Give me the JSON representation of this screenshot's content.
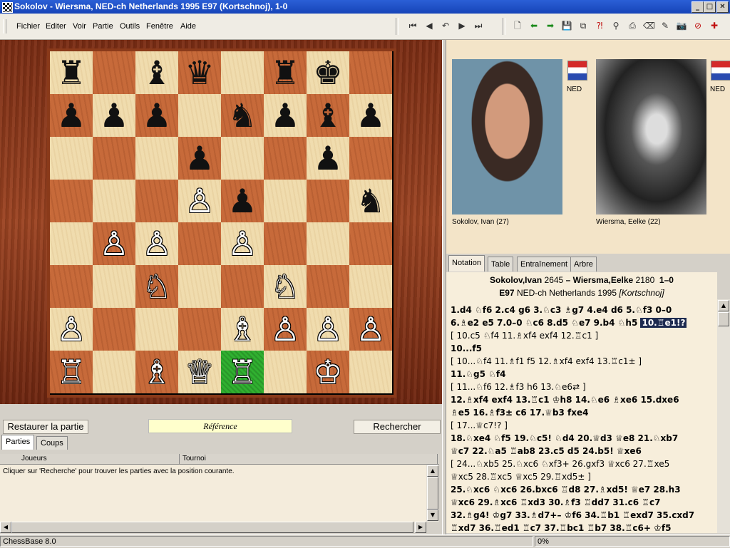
{
  "window": {
    "title": "Sokolov - Wiersma, NED-ch Netherlands 1995  E97  (Kortschnoj), 1-0",
    "controls": [
      "_",
      "□",
      "✕"
    ]
  },
  "menu": [
    "Fichier",
    "Editer",
    "Voir",
    "Partie",
    "Outils",
    "Fenêtre",
    "Aide"
  ],
  "icons": {
    "nav": [
      "first-move-icon",
      "prev-move-icon",
      "undo-icon",
      "next-move-icon",
      "last-move-icon"
    ],
    "tools": [
      "new-game-icon",
      "back-icon",
      "forward-icon",
      "save-icon",
      "replace-icon",
      "annotate-icon",
      "search-icon",
      "print-icon",
      "erase-icon",
      "clear-icon",
      "camera-icon",
      "report-icon",
      "cross-icon"
    ]
  },
  "board": {
    "highlight": "e1",
    "pieces": [
      {
        "sq": "a8",
        "p": "♜",
        "c": "b"
      },
      {
        "sq": "c8",
        "p": "♝",
        "c": "b"
      },
      {
        "sq": "d8",
        "p": "♛",
        "c": "b"
      },
      {
        "sq": "f8",
        "p": "♜",
        "c": "b"
      },
      {
        "sq": "g8",
        "p": "♚",
        "c": "b"
      },
      {
        "sq": "a7",
        "p": "♟",
        "c": "b"
      },
      {
        "sq": "b7",
        "p": "♟",
        "c": "b"
      },
      {
        "sq": "c7",
        "p": "♟",
        "c": "b"
      },
      {
        "sq": "e7",
        "p": "♞",
        "c": "b"
      },
      {
        "sq": "f7",
        "p": "♟",
        "c": "b"
      },
      {
        "sq": "g7",
        "p": "♝",
        "c": "b"
      },
      {
        "sq": "h7",
        "p": "♟",
        "c": "b"
      },
      {
        "sq": "d6",
        "p": "♟",
        "c": "b"
      },
      {
        "sq": "g6",
        "p": "♟",
        "c": "b"
      },
      {
        "sq": "d5",
        "p": "♙",
        "c": "w"
      },
      {
        "sq": "e5",
        "p": "♟",
        "c": "b"
      },
      {
        "sq": "h5",
        "p": "♞",
        "c": "b"
      },
      {
        "sq": "b4",
        "p": "♙",
        "c": "w"
      },
      {
        "sq": "c4",
        "p": "♙",
        "c": "w"
      },
      {
        "sq": "e4",
        "p": "♙",
        "c": "w"
      },
      {
        "sq": "c3",
        "p": "♘",
        "c": "w"
      },
      {
        "sq": "f3",
        "p": "♘",
        "c": "w"
      },
      {
        "sq": "a2",
        "p": "♙",
        "c": "w"
      },
      {
        "sq": "e2",
        "p": "♗",
        "c": "w"
      },
      {
        "sq": "f2",
        "p": "♙",
        "c": "w"
      },
      {
        "sq": "g2",
        "p": "♙",
        "c": "w"
      },
      {
        "sq": "h2",
        "p": "♙",
        "c": "w"
      },
      {
        "sq": "a1",
        "p": "♖",
        "c": "w"
      },
      {
        "sq": "c1",
        "p": "♗",
        "c": "w"
      },
      {
        "sq": "d1",
        "p": "♕",
        "c": "w"
      },
      {
        "sq": "e1",
        "p": "♖",
        "c": "w"
      },
      {
        "sq": "g1",
        "p": "♔",
        "c": "w"
      }
    ]
  },
  "players": {
    "white": {
      "label": "Sokolov, Ivan  (27)",
      "country": "NED"
    },
    "black": {
      "label": "Wiersma, Eelke  (22)",
      "country": "NED"
    }
  },
  "tabs": [
    "Notation",
    "Table",
    "Entraînement",
    "Arbre"
  ],
  "game": {
    "white": "Sokolov,Ivan",
    "white_elo": "2645",
    "dash": "–",
    "black": "Wiersma,Eelke",
    "black_elo": "2180",
    "result": "1–0",
    "eco": "E97",
    "event": "NED-ch Netherlands 1995",
    "annotator": "[Kortschnoj]"
  },
  "moves": [
    {
      "t": "1.d4  ♘f6  2.c4  g6  3.♘c3  ♗g7  4.e4  d6  5.♘f3  0–0",
      "v": false
    },
    {
      "t": "6.♗e2  e5  7.0–0  ♘c6  8.d5  ♘e7  9.b4  ♘h5 ",
      "v": false,
      "sel": "10.♖e1!?"
    },
    {
      "t": "  [ 10.c5  ♘f4  11.♗xf4  exf4  12.♖c1 ]",
      "v": true
    },
    {
      "t": "10...f5",
      "v": false
    },
    {
      "t": "  [ 10...♘f4  11.♗f1  f5  12.♗xf4  exf4  13.♖c1± ]",
      "v": true
    },
    {
      "t": "11.♘g5  ♘f4",
      "v": false
    },
    {
      "t": "  [ 11...♘f6  12.♗f3  h6  13.♘e6⇄ ]",
      "v": true
    },
    {
      "t": "12.♗xf4  exf4  13.♖c1  ♔h8  14.♘e6  ♗xe6  15.dxe6",
      "v": false
    },
    {
      "t": "♗e5  16.♗f3±  c6  17.♕b3  fxe4",
      "v": false
    },
    {
      "t": "  [ 17...♕c7!? ]",
      "v": true
    },
    {
      "t": "18.♘xe4  ♘f5  19.♘c5!  ♘d4  20.♕d3  ♕e8  21.♘xb7",
      "v": false
    },
    {
      "t": "♕c7  22.♘a5  ♖ab8  23.c5  d5  24.b5!  ♕xe6",
      "v": false
    },
    {
      "t": "  [ 24...♘xb5  25.♘xc6  ♘xf3+  26.gxf3  ♕xc6  27.♖xe5",
      "v": true
    },
    {
      "t": "  ♕xc5  28.♖xc5  ♕xc5  29.♖xd5± ]",
      "v": true
    },
    {
      "t": "25.♘xc6  ♘xc6  26.bxc6  ♖d8  27.♗xd5!  ♕e7  28.h3",
      "v": false
    },
    {
      "t": "♕xc6  29.♗xc6  ♖xd3  30.♗f3  ♖dd7  31.c6  ♖c7",
      "v": false
    },
    {
      "t": "32.♗g4!  ♔g7  33.♗d7+–  ♔f6  34.♖b1  ♖exd7  35.cxd7",
      "v": false
    },
    {
      "t": "♖xd7  36.♖ed1  ♖c7  37.♖bc1  ♖b7  38.♖c6+  ♔f5",
      "v": false
    }
  ],
  "bottom": {
    "restore_btn": "Restaurer la partie",
    "reference": "Référence",
    "search_btn": "Rechercher",
    "db_tabs": [
      "Parties",
      "Coups"
    ],
    "columns": [
      "Joueurs",
      "Tournoi"
    ],
    "message": "Cliquer sur 'Recherche' pour trouver les parties avec la position courante."
  },
  "status": {
    "app": "ChessBase 8.0",
    "progress": "0%"
  }
}
